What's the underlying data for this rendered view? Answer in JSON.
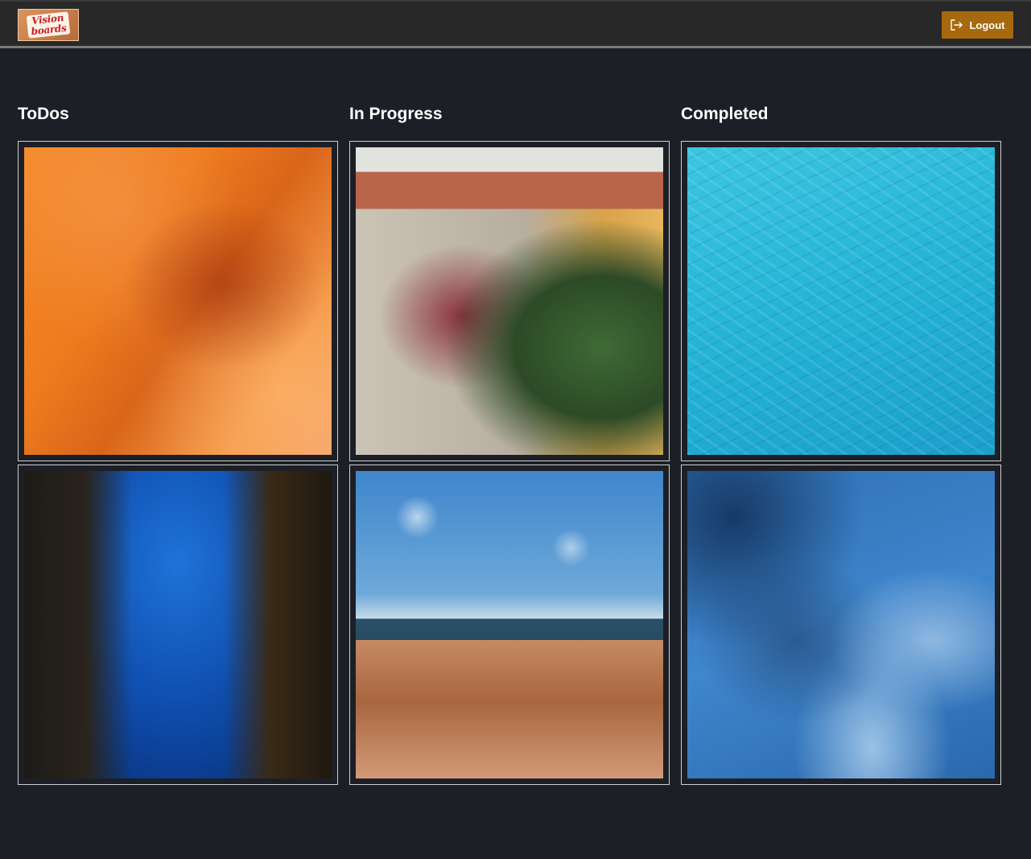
{
  "header": {
    "logo": {
      "line1": "Vision",
      "line2": "boards"
    },
    "logout_label": "Logout",
    "logout_icon": "logout-icon"
  },
  "columns": [
    {
      "title": "ToDos",
      "images": [
        "orange-fabric-image",
        "underwater-diver-image"
      ]
    },
    {
      "title": "In Progress",
      "images": [
        "ivy-covered-building-image",
        "rocky-coastline-image"
      ]
    },
    {
      "title": "Completed",
      "images": [
        "turquoise-water-image",
        "blue-clouds-image"
      ]
    }
  ],
  "colors": {
    "background": "#1d1f26",
    "topbar": "#282828",
    "accent": "#a7690d",
    "card_border": "#cfcfcf"
  }
}
